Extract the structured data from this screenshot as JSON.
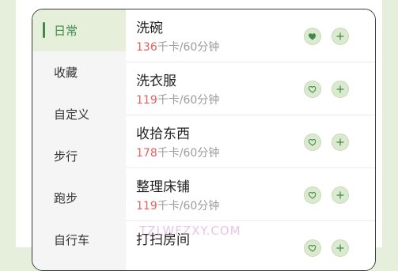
{
  "sidebar": {
    "items": [
      {
        "label": "日常",
        "active": true
      },
      {
        "label": "收藏",
        "active": false
      },
      {
        "label": "自定义",
        "active": false
      },
      {
        "label": "步行",
        "active": false
      },
      {
        "label": "跑步",
        "active": false
      },
      {
        "label": "自行车",
        "active": false
      }
    ]
  },
  "activities": [
    {
      "name": "洗碗",
      "kcal": "136",
      "unit": "千卡/60分钟",
      "favorited": true
    },
    {
      "name": "洗衣服",
      "kcal": "119",
      "unit": "千卡/60分钟",
      "favorited": false
    },
    {
      "name": "收拾东西",
      "kcal": "178",
      "unit": "千卡/60分钟",
      "favorited": false
    },
    {
      "name": "整理床铺",
      "kcal": "119",
      "unit": "千卡/60分钟",
      "favorited": false
    },
    {
      "name": "打扫房间",
      "kcal": "",
      "unit": "",
      "favorited": false
    }
  ],
  "watermark": "TZLWFZXY.COM",
  "colors": {
    "accent": "#3f8a4a",
    "kcal": "#e85d5d",
    "button_bg": "#dbe9cf",
    "sidebar_active_bg": "#e5efd9"
  },
  "icons": {
    "favorite": "heart-icon",
    "add": "plus-icon"
  }
}
